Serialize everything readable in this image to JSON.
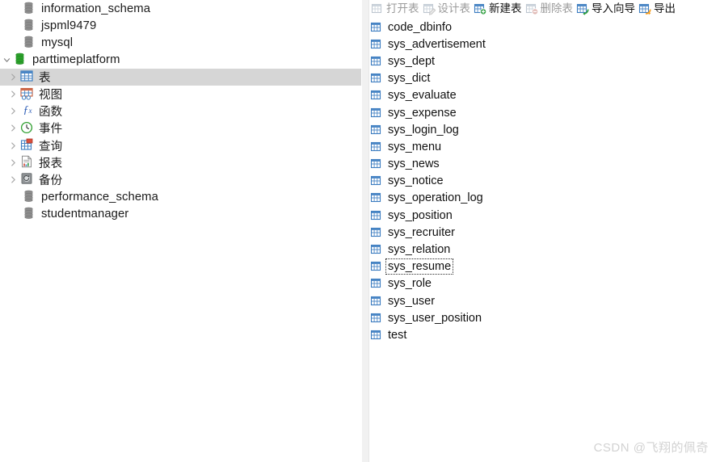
{
  "sidebar": {
    "name": "connection-tree",
    "nodes": [
      {
        "label": "information_schema",
        "type": "database",
        "state": "closed",
        "depth": 0,
        "selected": false
      },
      {
        "label": "jspml9479",
        "type": "database",
        "state": "closed",
        "depth": 0,
        "selected": false
      },
      {
        "label": "mysql",
        "type": "database",
        "state": "closed",
        "depth": 0,
        "selected": false
      },
      {
        "label": "parttimeplatform",
        "type": "database",
        "state": "open",
        "depth": 0,
        "selected": false,
        "twisty": "down"
      },
      {
        "label": "表",
        "type": "tables",
        "depth": 1,
        "selected": true,
        "twisty": "right"
      },
      {
        "label": "视图",
        "type": "views",
        "depth": 1,
        "selected": false,
        "twisty": "right"
      },
      {
        "label": "函数",
        "type": "functions",
        "depth": 1,
        "selected": false,
        "twisty": "right"
      },
      {
        "label": "事件",
        "type": "events",
        "depth": 1,
        "selected": false,
        "twisty": "right"
      },
      {
        "label": "查询",
        "type": "queries",
        "depth": 1,
        "selected": false,
        "twisty": "right"
      },
      {
        "label": "报表",
        "type": "reports",
        "depth": 1,
        "selected": false,
        "twisty": "right"
      },
      {
        "label": "备份",
        "type": "backups",
        "depth": 1,
        "selected": false,
        "twisty": "right"
      },
      {
        "label": "performance_schema",
        "type": "database",
        "state": "closed",
        "depth": 0,
        "selected": false
      },
      {
        "label": "studentmanager",
        "type": "database",
        "state": "closed",
        "depth": 0,
        "selected": false
      }
    ]
  },
  "toolbar": {
    "name": "object-toolbar",
    "buttons": [
      {
        "label": "打开表",
        "icon": "open-table-icon",
        "enabled": false
      },
      {
        "label": "设计表",
        "icon": "design-table-icon",
        "enabled": false
      },
      {
        "label": "新建表",
        "icon": "new-table-icon",
        "enabled": true
      },
      {
        "label": "删除表",
        "icon": "delete-table-icon",
        "enabled": false
      },
      {
        "label": "导入向导",
        "icon": "import-wizard-icon",
        "enabled": true
      },
      {
        "label": "导出",
        "icon": "export-wizard-icon",
        "enabled": true
      }
    ]
  },
  "table_list": {
    "name": "table-list",
    "focused_item": "sys_resume",
    "items": [
      "code_dbinfo",
      "sys_advertisement",
      "sys_dept",
      "sys_dict",
      "sys_evaluate",
      "sys_expense",
      "sys_login_log",
      "sys_menu",
      "sys_news",
      "sys_notice",
      "sys_operation_log",
      "sys_position",
      "sys_recruiter",
      "sys_relation",
      "sys_resume",
      "sys_role",
      "sys_user",
      "sys_user_position",
      "test"
    ]
  },
  "watermark": {
    "text": "CSDN @飞翔的佩奇"
  },
  "colors": {
    "table_icon_blue": "#3b7cc0",
    "db_open_green": "#2aa02a",
    "db_closed_gray": "#8a8a8a",
    "selection_gray": "#d6d6d6",
    "splitter_gray": "#f1f1f1",
    "disabled_text": "#9b9b9b",
    "watermark_gray": "#d2d2d2"
  }
}
